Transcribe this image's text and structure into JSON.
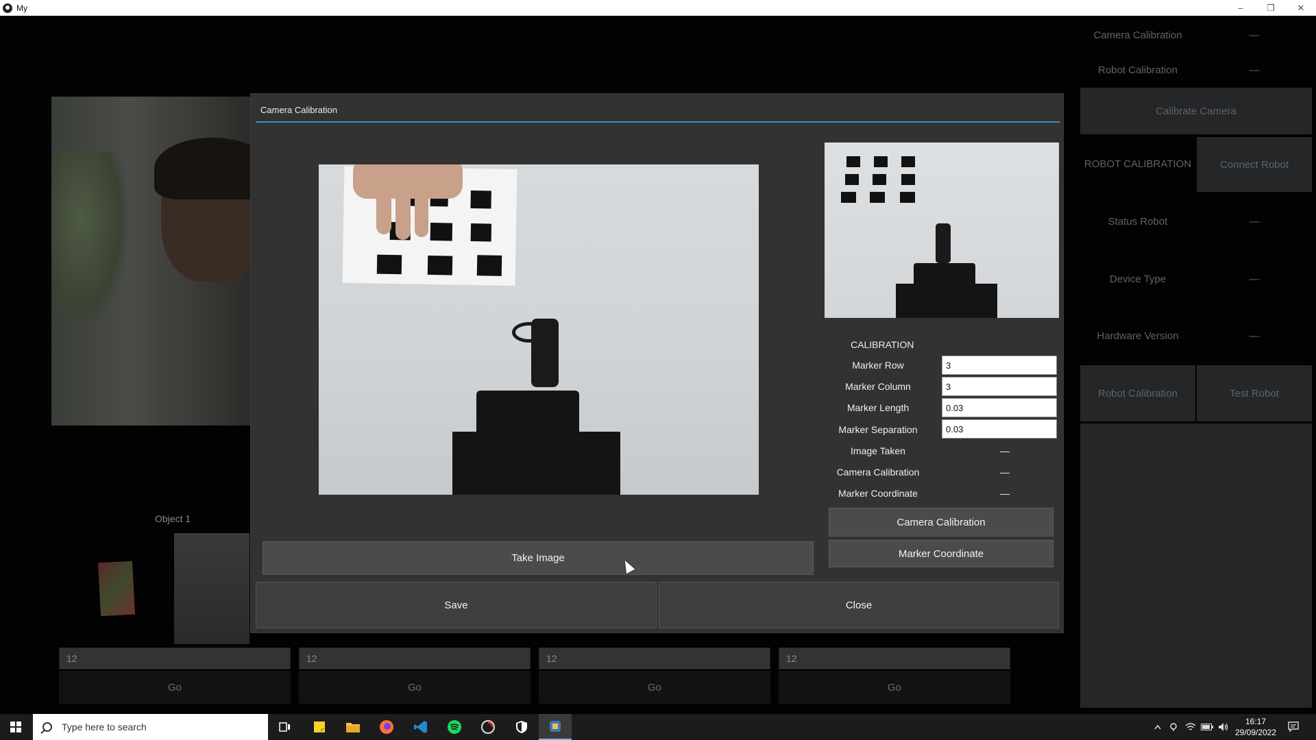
{
  "window": {
    "title": "My",
    "controls": {
      "minimize": "–",
      "maximize": "❐",
      "close": "✕"
    }
  },
  "background": {
    "object_label": "Object 1",
    "slots": [
      {
        "value": "12",
        "go_label": "Go"
      },
      {
        "value": "12",
        "go_label": "Go"
      },
      {
        "value": "12",
        "go_label": "Go"
      },
      {
        "value": "12",
        "go_label": "Go"
      }
    ]
  },
  "right_panel": {
    "camera_calibration_label": "Camera Calibration",
    "camera_calibration_value": "—",
    "robot_calibration_label": "Robot Calibration",
    "robot_calibration_value": "—",
    "calibrate_camera_button": "Calibrate Camera",
    "robot_calibration_heading": "ROBOT CALIBRATION",
    "connect_robot_button": "Connect Robot",
    "status_robot_label": "Status Robot",
    "status_robot_value": "—",
    "device_type_label": "Device Type",
    "device_type_value": "—",
    "hardware_version_label": "Hardware Version",
    "hardware_version_value": "—",
    "robot_calibration_button": "Robot Calibration",
    "test_robot_button": "Test Robot"
  },
  "dialog": {
    "title": "Camera Calibration",
    "calibration": {
      "heading": "CALIBRATION",
      "marker_row_label": "Marker Row",
      "marker_row_value": "3",
      "marker_column_label": "Marker Column",
      "marker_column_value": "3",
      "marker_length_label": "Marker Length",
      "marker_length_value": "0.03",
      "marker_separation_label": "Marker Separation",
      "marker_separation_value": "0.03",
      "image_taken_label": "Image Taken",
      "image_taken_value": "—",
      "camera_calibration_label": "Camera Calibration",
      "camera_calibration_value": "—",
      "marker_coordinate_label": "Marker Coordinate",
      "marker_coordinate_value": "—"
    },
    "buttons": {
      "camera_calibration": "Camera Calibration",
      "marker_coordinate": "Marker Coordinate",
      "take_image": "Take Image",
      "save": "Save",
      "close": "Close"
    }
  },
  "taskbar": {
    "search_placeholder": "Type here to search",
    "time": "16:17",
    "date": "29/09/2022"
  },
  "colors": {
    "dialog_accent": "#3d8fc4",
    "dialog_bg": "#323232",
    "button_bg": "#4b4b4b"
  }
}
